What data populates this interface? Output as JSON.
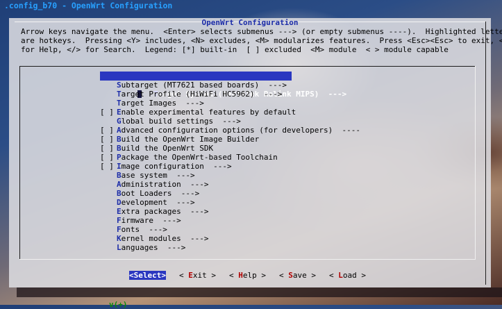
{
  "window": {
    "title": ".config_b70 - OpenWrt Configuration"
  },
  "dialog": {
    "title": "OpenWrt Configuration",
    "help_lines": [
      "Arrow keys navigate the menu.  <Enter> selects submenus ---> (or empty submenus ----).  Highlighted letters",
      "are hotkeys.  Pressing <Y> includes, <N> excludes, <M> modularizes features.  Press <Esc><Esc> to exit, <?>",
      "for Help, </> for Search.  Legend: [*] built-in  [ ] excluded  <M> module  < > module capable"
    ]
  },
  "menu": {
    "items": [
      {
        "prefix": "",
        "hot": "T",
        "rest": "arget System (MediaTek Ralink MIPS)  --->",
        "selected": true
      },
      {
        "prefix": "",
        "hot": "S",
        "rest": "ubtarget (MT7621 based boards)  --->"
      },
      {
        "prefix": "",
        "hot": "T",
        "rest": "arget Profile (HiWiFi HC5962)  --->"
      },
      {
        "prefix": "",
        "hot": "T",
        "rest": "arget Images  --->"
      },
      {
        "prefix": "[ ]",
        "hot": "E",
        "rest": "nable experimental features by default"
      },
      {
        "prefix": "",
        "hot": "G",
        "rest": "lobal build settings  --->"
      },
      {
        "prefix": "[ ]",
        "hot": "A",
        "rest": "dvanced configuration options (for developers)  ----"
      },
      {
        "prefix": "[ ]",
        "hot": "B",
        "rest": "uild the OpenWrt Image Builder"
      },
      {
        "prefix": "[ ]",
        "hot": "B",
        "rest": "uild the OpenWrt SDK"
      },
      {
        "prefix": "[ ]",
        "hot": "P",
        "rest": "ackage the OpenWrt-based Toolchain"
      },
      {
        "prefix": "[ ]",
        "hot": "I",
        "rest": "mage configuration  --->"
      },
      {
        "prefix": "",
        "hot": "B",
        "rest": "ase system  --->"
      },
      {
        "prefix": "",
        "hot": "A",
        "rest": "dministration  --->"
      },
      {
        "prefix": "",
        "hot": "B",
        "rest": "oot Loaders  --->"
      },
      {
        "prefix": "",
        "hot": "D",
        "rest": "evelopment  --->"
      },
      {
        "prefix": "",
        "hot": "E",
        "rest": "xtra packages  --->"
      },
      {
        "prefix": "",
        "hot": "F",
        "rest": "irmware  --->"
      },
      {
        "prefix": "",
        "hot": "F",
        "rest": "onts  --->"
      },
      {
        "prefix": "",
        "hot": "K",
        "rest": "ernel modules  --->"
      },
      {
        "prefix": "",
        "hot": "L",
        "rest": "anguages  --->"
      }
    ],
    "more_indicator": "v(+)"
  },
  "buttons": {
    "select": {
      "pre": "<",
      "hot": "S",
      "post": "elect>"
    },
    "exit": {
      "pre": "< ",
      "hot": "E",
      "post": "xit >"
    },
    "help": {
      "pre": "< ",
      "hot": "H",
      "post": "elp >"
    },
    "save": {
      "pre": "< ",
      "hot": "S",
      "post": "ave >"
    },
    "load": {
      "pre": "< ",
      "hot": "L",
      "post": "oad >"
    }
  },
  "colors": {
    "title_blue": "#28a0ff",
    "hotkey_blue": "#1c2ca8",
    "selection_blue": "#2a37c0",
    "button_hotkey_red": "#b00000",
    "more_green": "#0a8a0a"
  }
}
